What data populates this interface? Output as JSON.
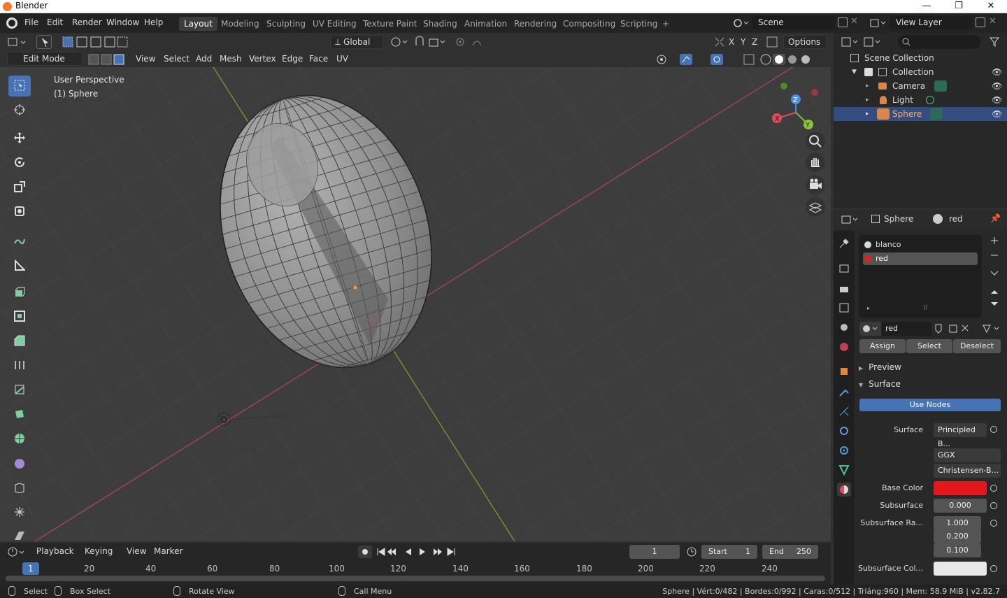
{
  "window": {
    "title": "Blender",
    "minimize": "—",
    "maximize": "❐",
    "close": "✕"
  },
  "menu": [
    "File",
    "Edit",
    "Render",
    "Window",
    "Help"
  ],
  "workspaces": [
    "Layout",
    "Modeling",
    "Sculpting",
    "UV Editing",
    "Texture Paint",
    "Shading",
    "Animation",
    "Rendering",
    "Compositing",
    "Scripting",
    "+"
  ],
  "scene": {
    "scene_name": "Scene",
    "view_layer": "View Layer"
  },
  "viewport_header": {
    "transform": "Global",
    "options": "Options",
    "axes": [
      "X",
      "Y",
      "Z"
    ],
    "mode": "Edit Mode",
    "menus": [
      "View",
      "Select",
      "Add",
      "Mesh",
      "Vertex",
      "Edge",
      "Face",
      "UV"
    ]
  },
  "viewport": {
    "perspective": "User Perspective",
    "object": "(1) Sphere"
  },
  "gizmo": {
    "x": "X",
    "y": "Y",
    "z": "Z"
  },
  "outliner": {
    "root": "Scene Collection",
    "collection": "Collection",
    "items": [
      "Camera",
      "Light",
      "Sphere"
    ],
    "selected": "Sphere"
  },
  "properties": {
    "object": "Sphere",
    "material": "red",
    "slots": [
      "blanco",
      "red"
    ],
    "slot_colors": [
      "#d8d8d8",
      "#e02020"
    ],
    "material_field": "red",
    "assign": "Assign",
    "select": "Select",
    "deselect": "Deselect",
    "preview": "Preview",
    "surface_section": "Surface",
    "use_nodes": "Use Nodes",
    "surface_label": "Surface",
    "surface_value": "Principled B...",
    "distribution": "GGX",
    "subsurface_method": "Christensen-B...",
    "base_color_label": "Base Color",
    "base_color": "#e3171e",
    "subsurface_label": "Subsurface",
    "subsurface_value": "0.000",
    "subsurface_radius_label": "Subsurface Ra...",
    "subsurface_radius": [
      "1.000",
      "0.200",
      "0.100"
    ],
    "subsurface_color_label": "Subsurface Col..."
  },
  "timeline": {
    "menus": [
      "Playback",
      "Keying",
      "View",
      "Marker"
    ],
    "current_frame": "1",
    "start_label": "Start",
    "start": "1",
    "end_label": "End",
    "end": "250",
    "ticks": [
      "1",
      "20",
      "40",
      "60",
      "80",
      "100",
      "120",
      "140",
      "160",
      "180",
      "200",
      "220",
      "240"
    ]
  },
  "status": {
    "select": "Select",
    "box_select": "Box Select",
    "rotate_view": "Rotate View",
    "call_menu": "Call Menu",
    "stats": "Sphere | Vért:0/482 | Bordes:0/992 | Caras:0/512 | Triáng:960 | Mem: 58.9 MiB | v2.82.7"
  }
}
